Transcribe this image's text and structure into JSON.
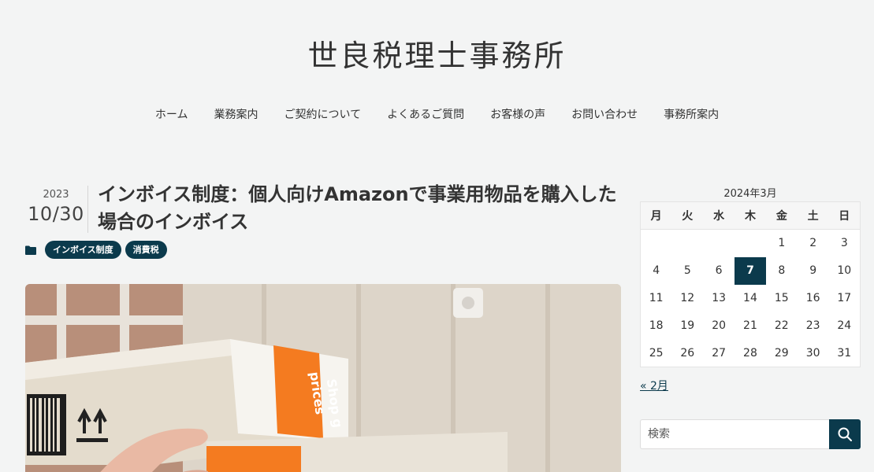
{
  "site": {
    "title": "世良税理士事務所"
  },
  "nav": {
    "items": [
      {
        "label": "ホーム"
      },
      {
        "label": "業務案内"
      },
      {
        "label": "ご契約について"
      },
      {
        "label": "よくあるご質問"
      },
      {
        "label": "お客様の声"
      },
      {
        "label": "お問い合わせ"
      },
      {
        "label": "事務所案内"
      }
    ]
  },
  "post": {
    "year": "2023",
    "month_day": "10/30",
    "title": "インボイス制度：個人向けAmazonで事業用物品を購入した場合のインボイス",
    "categories": [
      "インボイス制度",
      "消費税"
    ],
    "image": {
      "description": "cardboard boxes",
      "box_text": "Shop g prices",
      "accent": "#f47b20"
    }
  },
  "calendar": {
    "caption": "2024年3月",
    "weekdays": [
      "月",
      "火",
      "水",
      "木",
      "金",
      "土",
      "日"
    ],
    "weeks": [
      [
        "",
        "",
        "",
        "",
        "1",
        "2",
        "3"
      ],
      [
        "4",
        "5",
        "6",
        "7",
        "8",
        "9",
        "10"
      ],
      [
        "11",
        "12",
        "13",
        "14",
        "15",
        "16",
        "17"
      ],
      [
        "18",
        "19",
        "20",
        "21",
        "22",
        "23",
        "24"
      ],
      [
        "25",
        "26",
        "27",
        "28",
        "29",
        "30",
        "31"
      ]
    ],
    "today": "7",
    "prev_label": "« 2月"
  },
  "search": {
    "placeholder": "検索",
    "icon": "search-icon"
  },
  "colors": {
    "accent": "#0b3a4c",
    "background": "#f3f4f4"
  }
}
